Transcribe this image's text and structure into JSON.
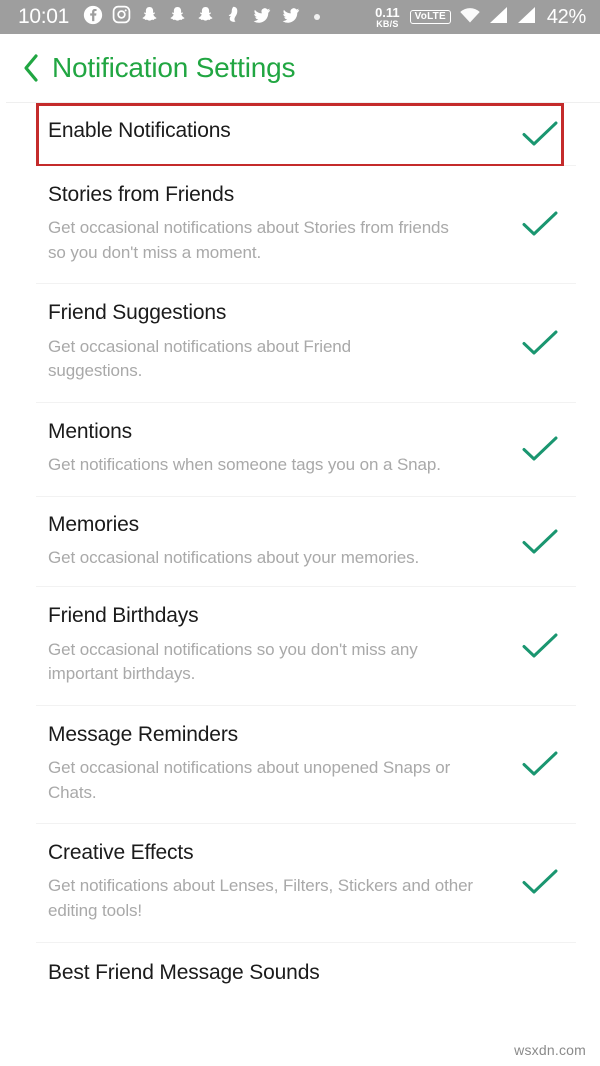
{
  "statusbar": {
    "clock": "10:01",
    "left_icons": [
      "facebook-icon",
      "instagram-icon",
      "snapchat-icon",
      "snapchat-icon",
      "snapchat-icon",
      "snapchat-ghost-icon",
      "twitter-icon",
      "twitter-icon",
      "dot-indicator-icon"
    ],
    "network_speed_value": "0.11",
    "network_speed_unit": "KB/S",
    "volte_label": "VoLTE",
    "right_icons": [
      "wifi-icon",
      "signal-bars-icon",
      "signal-bars-icon"
    ],
    "battery": "42%",
    "background": "#9e9e9e"
  },
  "header": {
    "back_icon": "chevron-left-icon",
    "title": "Notification Settings",
    "accent": "#21a642"
  },
  "theme": {
    "check_color": "#1a9670",
    "highlight_color": "#c42b2b",
    "title_color": "#1b1b1b",
    "desc_color": "#a9a9a9",
    "divider_color": "#f2f2f2"
  },
  "highlighted_row_index": 0,
  "rows": [
    {
      "title": "Enable Notifications",
      "desc": "",
      "checked": true,
      "highlighted": true
    },
    {
      "title": "Stories from Friends",
      "desc": "Get occasional notifications about Stories from friends so you don't miss a moment.",
      "checked": true,
      "highlighted": false
    },
    {
      "title": "Friend Suggestions",
      "desc": "Get occasional notifications about Friend suggestions.",
      "checked": true,
      "highlighted": false
    },
    {
      "title": "Mentions",
      "desc": "Get notifications when someone tags you on a Snap.",
      "checked": true,
      "highlighted": false
    },
    {
      "title": "Memories",
      "desc": "Get occasional notifications about your memories.",
      "checked": true,
      "highlighted": false
    },
    {
      "title": "Friend Birthdays",
      "desc": "Get occasional notifications so you don't miss any important birthdays.",
      "checked": true,
      "highlighted": false
    },
    {
      "title": "Message Reminders",
      "desc": "Get occasional notifications about unopened Snaps or Chats.",
      "checked": true,
      "highlighted": false
    },
    {
      "title": "Creative Effects",
      "desc": "Get notifications about Lenses, Filters, Stickers and other editing tools!",
      "checked": true,
      "highlighted": false
    },
    {
      "title": "Best Friend Message Sounds",
      "desc": "",
      "checked": false,
      "highlighted": false
    }
  ],
  "watermark": "wsxdn.com"
}
